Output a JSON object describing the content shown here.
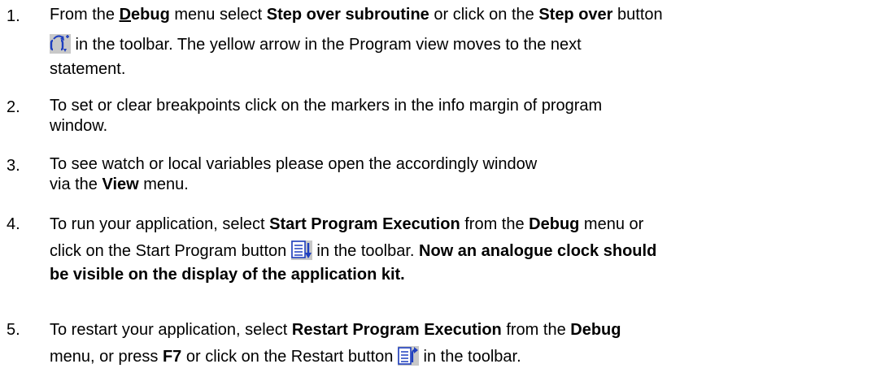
{
  "steps": [
    {
      "number": "1.",
      "s1": "From the ",
      "menu_debug_d": "D",
      "menu_debug_rest": "ebug",
      "s2": " menu select ",
      "cmd_step_over_sub": "Step over subroutine",
      "s3": " or click on the ",
      "cmd_step_over": "Step over",
      "s4": " button",
      "icon": "step-over-icon",
      "s5": " in the toolbar. The yellow arrow in the Program view moves to the next",
      "s6": "statement."
    },
    {
      "number": "2.",
      "line1": "To set or clear breakpoints click on the markers in the info margin of program",
      "line2": "window."
    },
    {
      "number": "3.",
      "line1": "To see watch or local variables please open the accordingly window",
      "s1": "via the ",
      "menu_view": "View",
      "s2": " menu."
    },
    {
      "number": "4.",
      "s1": "To run your application, select ",
      "cmd_start": "Start Program Execution",
      "s2": " from the ",
      "menu_debug": "Debug",
      "s3": " menu or",
      "s4": "click on the Start Program button ",
      "icon": "start-program-icon",
      "s5": " in the toolbar. ",
      "bold1": "Now an analogue clock should",
      "bold2": "be visible on the display of the application kit."
    },
    {
      "number": "5.",
      "s1": "To restart your application, select ",
      "cmd_restart": "Restart Program Execution",
      "s2": " from the ",
      "menu_debug": "Debug",
      "s3": "menu, or press ",
      "key": "F7",
      "s4": " or click on the Restart button ",
      "icon": "restart-icon",
      "s5": " in the toolbar."
    }
  ],
  "colors": {
    "icon_blue": "#1f3fbf",
    "icon_bg": "#c8c8c8",
    "text": "#000000"
  }
}
